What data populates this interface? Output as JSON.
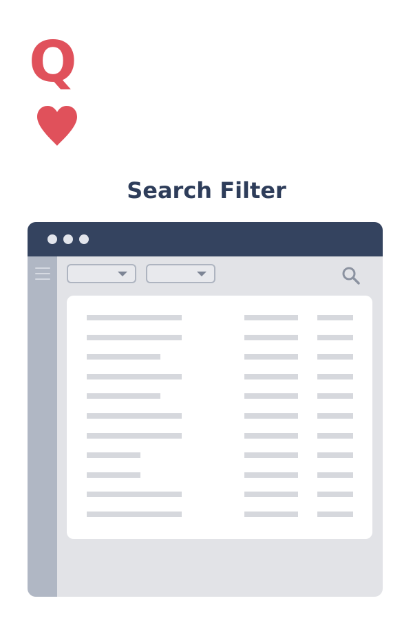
{
  "card_corner": {
    "rank": "Q",
    "suit_icon": "heart-icon",
    "color": "#e0515b"
  },
  "title": "Search Filter",
  "window": {
    "titlebar_color": "#34435f",
    "sidebar_color": "#b0b7c4",
    "content_bg": "#e2e3e7",
    "controls": [
      "dot-icon",
      "dot-icon",
      "dot-icon"
    ],
    "menu_icon": "hamburger-icon",
    "filters": [
      {
        "name": "filter-dropdown-1",
        "icon": "caret-down-icon"
      },
      {
        "name": "filter-dropdown-2",
        "icon": "caret-down-icon"
      }
    ],
    "search_icon": "search-icon",
    "rows": [
      {
        "placeholder_text": true,
        "columns": 3
      },
      {
        "placeholder_text": true,
        "columns": 3
      },
      {
        "placeholder_text": true,
        "columns": 3
      },
      {
        "placeholder_text": true,
        "columns": 3
      },
      {
        "placeholder_text": true,
        "columns": 3
      },
      {
        "placeholder_text": true,
        "columns": 3
      },
      {
        "placeholder_text": true,
        "columns": 3
      },
      {
        "placeholder_text": true,
        "columns": 3
      },
      {
        "placeholder_text": true,
        "columns": 3
      },
      {
        "placeholder_text": true,
        "columns": 3
      },
      {
        "placeholder_text": true,
        "columns": 3
      }
    ]
  }
}
